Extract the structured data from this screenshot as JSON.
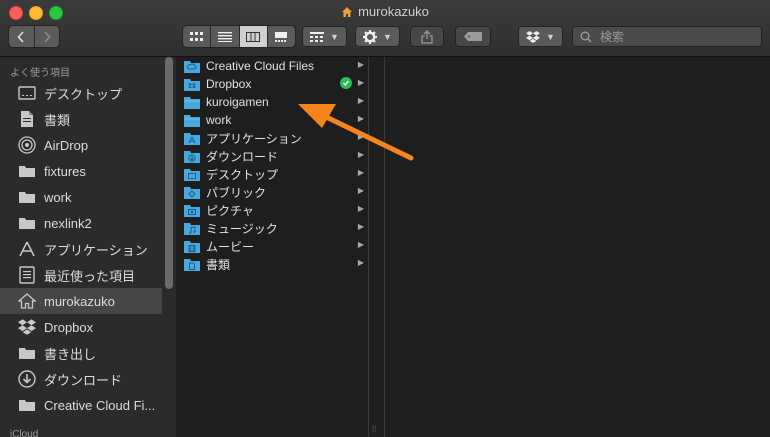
{
  "window": {
    "title": "murokazuko"
  },
  "toolbar": {
    "search_placeholder": "検索",
    "colors": {
      "close": "#fe5f57",
      "minimize": "#febc2e",
      "maximize": "#28c840"
    }
  },
  "sidebar": {
    "heading": "よく使う項目",
    "heading2": "iCloud",
    "items": [
      {
        "label": "デスクトップ",
        "icon": "desktop-icon"
      },
      {
        "label": "書類",
        "icon": "document-icon"
      },
      {
        "label": "AirDrop",
        "icon": "airdrop-icon"
      },
      {
        "label": "fixtures",
        "icon": "folder-icon"
      },
      {
        "label": "work",
        "icon": "folder-icon"
      },
      {
        "label": "nexlink2",
        "icon": "folder-icon"
      },
      {
        "label": "アプリケーション",
        "icon": "applications-icon"
      },
      {
        "label": "最近使った項目",
        "icon": "recents-icon"
      },
      {
        "label": "murokazuko",
        "icon": "home-icon",
        "selected": true
      },
      {
        "label": "Dropbox",
        "icon": "dropbox-icon"
      },
      {
        "label": "書き出し",
        "icon": "folder-icon"
      },
      {
        "label": "ダウンロード",
        "icon": "downloads-icon"
      },
      {
        "label": "Creative Cloud Fi...",
        "icon": "folder-icon"
      }
    ]
  },
  "column": {
    "items": [
      {
        "label": "Creative Cloud Files",
        "icon": "cc-folder-icon"
      },
      {
        "label": "Dropbox",
        "icon": "dropbox-folder-icon",
        "synced": true
      },
      {
        "label": "kuroigamen",
        "icon": "folder-icon"
      },
      {
        "label": "work",
        "icon": "folder-icon"
      },
      {
        "label": "アプリケーション",
        "icon": "applications-folder-icon"
      },
      {
        "label": "ダウンロード",
        "icon": "downloads-folder-icon"
      },
      {
        "label": "デスクトップ",
        "icon": "desktop-folder-icon"
      },
      {
        "label": "パブリック",
        "icon": "public-folder-icon"
      },
      {
        "label": "ピクチャ",
        "icon": "pictures-folder-icon"
      },
      {
        "label": "ミュージック",
        "icon": "music-folder-icon"
      },
      {
        "label": "ムービー",
        "icon": "movies-folder-icon"
      },
      {
        "label": "書類",
        "icon": "documents-folder-icon"
      }
    ]
  },
  "annotation": {
    "color": "#f5841f"
  }
}
